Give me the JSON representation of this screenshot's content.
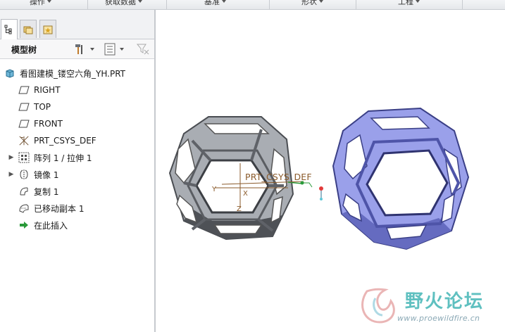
{
  "ribbon": {
    "groups": [
      "操作",
      "获取数据",
      "基准",
      "形状",
      "工程"
    ]
  },
  "left_panel": {
    "tabs": [
      "model-tree-tab",
      "folder-browser-tab",
      "favorites-tab"
    ],
    "toolbar": {
      "title": "模型树"
    },
    "tree": [
      {
        "label": "看图建模_镂空六角_YH.PRT",
        "icon": "part-icon",
        "expandable": false
      },
      {
        "label": "RIGHT",
        "icon": "datum-plane-icon",
        "expandable": false
      },
      {
        "label": "TOP",
        "icon": "datum-plane-icon",
        "expandable": false
      },
      {
        "label": "FRONT",
        "icon": "datum-plane-icon",
        "expandable": false
      },
      {
        "label": "PRT_CSYS_DEF",
        "icon": "csys-icon",
        "expandable": false
      },
      {
        "label": "阵列 1 / 拉伸 1",
        "icon": "pattern-icon",
        "expandable": true
      },
      {
        "label": "镜像 1",
        "icon": "mirror-icon",
        "expandable": true
      },
      {
        "label": "复制 1",
        "icon": "copy-icon",
        "expandable": false
      },
      {
        "label": "已移动副本 1",
        "icon": "moved-copy-icon",
        "expandable": false
      },
      {
        "label": "在此插入",
        "icon": "insert-here-arrow-icon",
        "expandable": false
      }
    ]
  },
  "viewport": {
    "csys_label": "PRT_CSYS_DEF",
    "axis_x": "X",
    "axis_y": "Y",
    "axis_z": "Z",
    "colors": {
      "grey_model": "#8f9399",
      "blue_model": "#8c91e0",
      "csys": "#8a5a2a"
    }
  },
  "watermark": {
    "title": "野火论坛",
    "url": "www.proewildfire.cn"
  }
}
